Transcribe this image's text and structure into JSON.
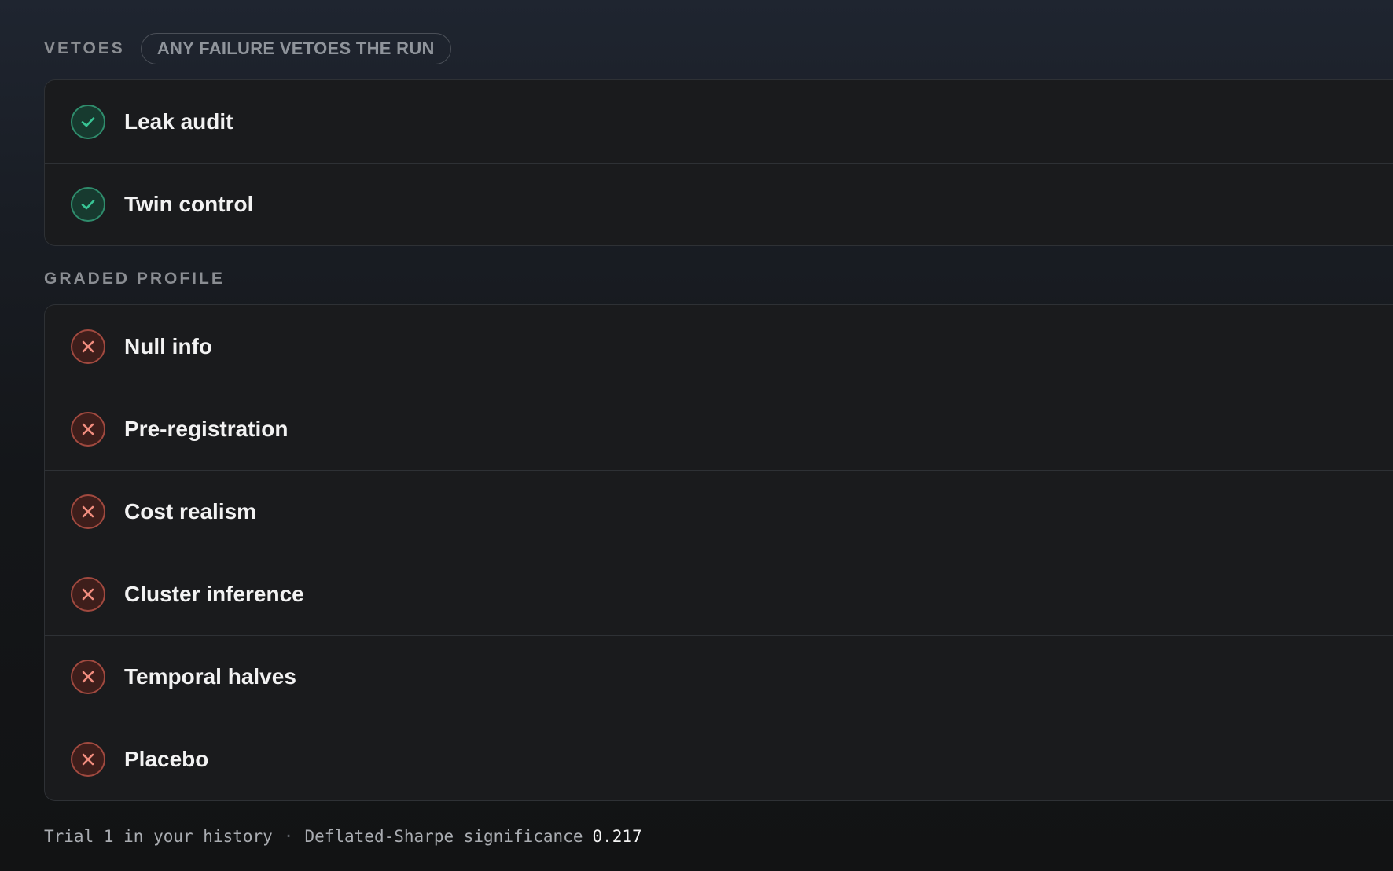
{
  "vetoes": {
    "label": "VETOES",
    "pill": "ANY FAILURE VETOES THE RUN",
    "items": [
      {
        "label": "Leak audit",
        "status": "pass"
      },
      {
        "label": "Twin control",
        "status": "pass"
      }
    ]
  },
  "graded_profile": {
    "label": "GRADED PROFILE",
    "items": [
      {
        "label": "Null info",
        "status": "fail"
      },
      {
        "label": "Pre-registration",
        "status": "fail"
      },
      {
        "label": "Cost realism",
        "status": "fail"
      },
      {
        "label": "Cluster inference",
        "status": "fail"
      },
      {
        "label": "Temporal halves",
        "status": "fail"
      },
      {
        "label": "Placebo",
        "status": "fail"
      }
    ]
  },
  "footer": {
    "trial_text": "Trial 1 in your history",
    "separator": "·",
    "significance_label": "Deflated-Sharpe significance",
    "significance_value": "0.217"
  },
  "colors": {
    "pass_icon": "#38c494",
    "fail_icon": "#f08c7e"
  },
  "icons": {
    "pass": "check-icon",
    "fail": "x-icon"
  }
}
